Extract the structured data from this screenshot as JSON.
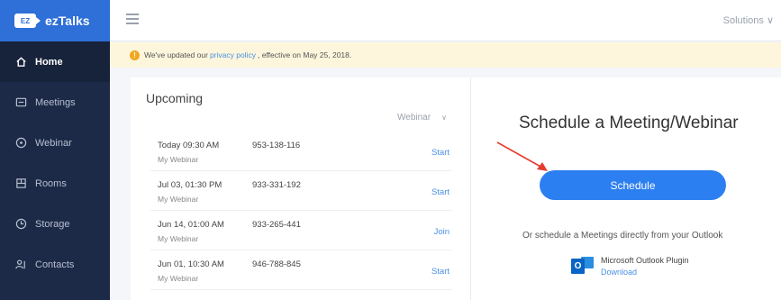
{
  "brand": {
    "logo_text": "EZ",
    "name": "ezTalks"
  },
  "sidebar": {
    "items": [
      {
        "label": "Home",
        "icon": "home-icon",
        "active": true
      },
      {
        "label": "Meetings",
        "icon": "monitor-icon",
        "active": false
      },
      {
        "label": "Webinar",
        "icon": "webinar-icon",
        "active": false
      },
      {
        "label": "Rooms",
        "icon": "rooms-icon",
        "active": false
      },
      {
        "label": "Storage",
        "icon": "storage-icon",
        "active": false
      },
      {
        "label": "Contacts",
        "icon": "contacts-icon",
        "active": false
      }
    ]
  },
  "topbar": {
    "solutions_label": "Solutions ∨"
  },
  "notice": {
    "before": "We've updated our",
    "link": "privacy policy",
    "after": ", effective on May 25, 2018."
  },
  "upcoming": {
    "title": "Upcoming",
    "filter_label": "Webinar",
    "rows": [
      {
        "time": "Today 09:30 AM",
        "sub": "My Webinar",
        "id": "953-138-116",
        "action": "Start"
      },
      {
        "time": "Jul 03, 01:30 PM",
        "sub": "My Webinar",
        "id": "933-331-192",
        "action": "Start"
      },
      {
        "time": "Jun 14, 01:00 AM",
        "sub": "My Webinar",
        "id": "933-265-441",
        "action": "Join"
      },
      {
        "time": "Jun 01, 10:30 AM",
        "sub": "My Webinar",
        "id": "946-788-845",
        "action": "Start"
      }
    ]
  },
  "schedule": {
    "title": "Schedule a Meeting/Webinar",
    "button_label": "Schedule",
    "or_text": "Or schedule a Meetings directly from your Outlook",
    "plugin_name": "Microsoft Outlook Plugin",
    "download_label": "Download"
  },
  "colors": {
    "accent": "#2c7ff0",
    "sidebar": "#1d2a47",
    "brand": "#2e6fd8",
    "arrow": "#e63c2f",
    "notice": "#fdf6dc"
  }
}
